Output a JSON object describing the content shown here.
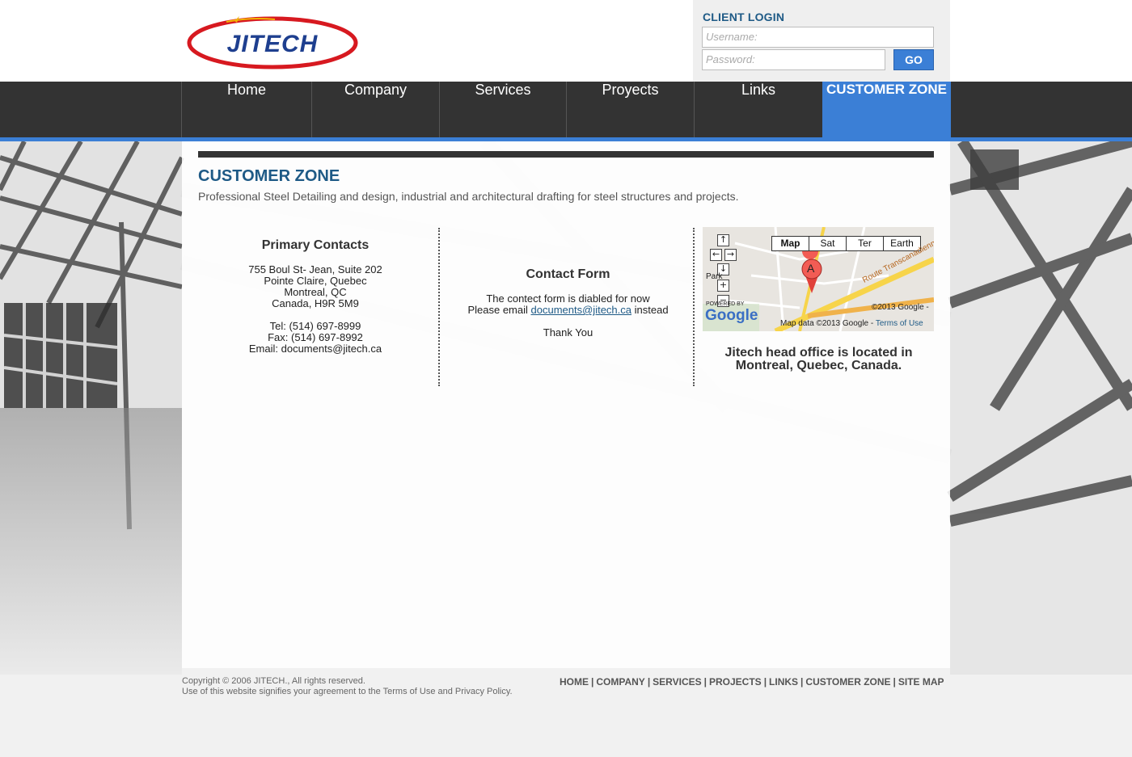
{
  "brand": {
    "logo_text": "JITECH",
    "accent": "#3b7fd6",
    "dark": "#333333",
    "title_color": "#1e5a86"
  },
  "login": {
    "title": "CLIENT LOGIN",
    "username_placeholder": "Username:",
    "password_placeholder": "Password:",
    "go_label": "GO"
  },
  "nav": {
    "items": [
      {
        "label": "Home"
      },
      {
        "label": "Company"
      },
      {
        "label": "Services"
      },
      {
        "label": "Proyects"
      },
      {
        "label": "Links"
      },
      {
        "label": "CUSTOMER ZONE",
        "active": true
      }
    ]
  },
  "page": {
    "title": "CUSTOMER ZONE",
    "subtitle": "Professional Steel Detailing and design, industrial and architectural drafting for steel structures and projects."
  },
  "contacts": {
    "heading": "Primary Contacts",
    "address1": "755 Boul St- Jean, Suite 202",
    "address2": "Pointe Claire, Quebec",
    "address3": "Montreal, QC",
    "address4": "Canada, H9R 5M9",
    "tel": "Tel: (514) 697-8999",
    "fax": "Fax: (514) 697-8992",
    "email": "Email: documents@jitech.ca"
  },
  "contact_form": {
    "heading": "Contact Form",
    "line1": "The contect form is diabled for now",
    "line2_prefix": "Please email",
    "email_link": "documents@jitech.ca",
    "line2_suffix": "instead",
    "thanks": "Thank You"
  },
  "map": {
    "types": [
      "Map",
      "Sat",
      "Ter",
      "Earth"
    ],
    "selected": "Map",
    "marker": "A",
    "park_label": "Park",
    "powered_by": "POWERED BY",
    "google": "Google",
    "road_label": "Route Transcanadienne",
    "copyright": "©2013 Google -",
    "map_data": "Map data ©2013 Google -",
    "terms": "Terms of Use",
    "caption": "Jitech head office is located in Montreal, Quebec, Canada."
  },
  "footer": {
    "copyright": "Copyright © 2006 JITECH., All rights reserved.",
    "notice": "Use of this website signifies your agreement to the Terms of Use and Privacy Policy.",
    "links": [
      "HOME",
      "COMPANY",
      "SERVICES",
      "PROJECTS",
      "LINKS",
      "CUSTOMER ZONE",
      "SITE MAP"
    ]
  }
}
